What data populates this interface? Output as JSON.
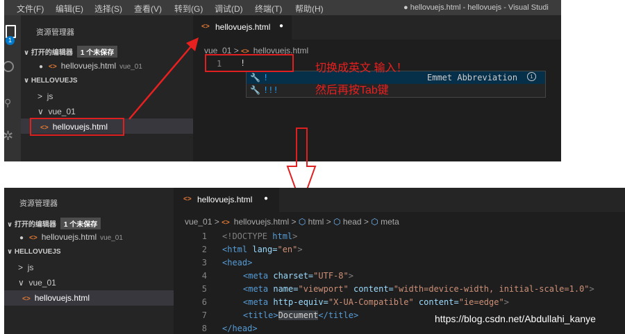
{
  "top": {
    "menu": [
      "文件(F)",
      "编辑(E)",
      "选择(S)",
      "查看(V)",
      "转到(G)",
      "调试(D)",
      "终端(T)",
      "帮助(H)"
    ],
    "window_title": "● hellovuejs.html - hellovuejs - Visual Studi",
    "activity_badge": "1",
    "explorer_title": "资源管理器",
    "open_editors": "打开的编辑器",
    "unsaved_badge": "1 个未保存",
    "open_file": "hellovuejs.html",
    "open_file_dir": "vue_01",
    "project": "HELLOVUEJS",
    "folders": [
      "js",
      "vue_01"
    ],
    "tree_file": "hellovuejs.html",
    "tab": "hellovuejs.html",
    "breadcrumb": [
      "vue_01",
      ">",
      "hellovuejs.html"
    ],
    "line_num": "1",
    "line_text": "!",
    "suggestions": [
      {
        "label": "!",
        "detail": "Emmet Abbreviation"
      },
      {
        "label": "!!!",
        "detail": ""
      }
    ],
    "annotation1": "切换成英文  输入！",
    "annotation2": "然后再按Tab键"
  },
  "bottom": {
    "explorer_title": "资源管理器",
    "open_editors": "打开的编辑器",
    "unsaved_badge": "1 个未保存",
    "open_file": "hellovuejs.html",
    "open_file_dir": "vue_01",
    "project": "HELLOVUEJS",
    "folders": [
      "js",
      "vue_01"
    ],
    "tree_file": "hellovuejs.html",
    "tab": "hellovuejs.html",
    "breadcrumb": [
      "vue_01",
      ">",
      "hellovuejs.html",
      ">",
      "html",
      ">",
      "head",
      ">",
      "meta"
    ],
    "lines": [
      {
        "num": "1",
        "a": "<!DOCTYPE ",
        "b": "html",
        "c": ">"
      },
      {
        "num": "2",
        "a": "<html ",
        "b": "lang=",
        "c": "\"en\"",
        "d": ">"
      },
      {
        "num": "3",
        "a": "<head>"
      },
      {
        "num": "4",
        "a": "<meta ",
        "b": "charset=",
        "c": "\"UTF-8\"",
        "d": ">"
      },
      {
        "num": "5",
        "a": "<meta ",
        "b": "name=",
        "c": "\"viewport\" ",
        "e": "content=",
        "f": "\"width=device-width, initial-scale=1.0\"",
        "d": ">"
      },
      {
        "num": "6",
        "a": "<meta ",
        "b": "http-equiv=",
        "c": "\"X-UA-Compatible\" ",
        "e": "content=",
        "f": "\"ie=edge\"",
        "d": ">"
      },
      {
        "num": "7",
        "a": "<title>",
        "b": "Document",
        "c": "</title>"
      },
      {
        "num": "8",
        "a": "</head>"
      }
    ]
  },
  "watermark": "https://blog.csdn.net/Abdullahi_kanye"
}
